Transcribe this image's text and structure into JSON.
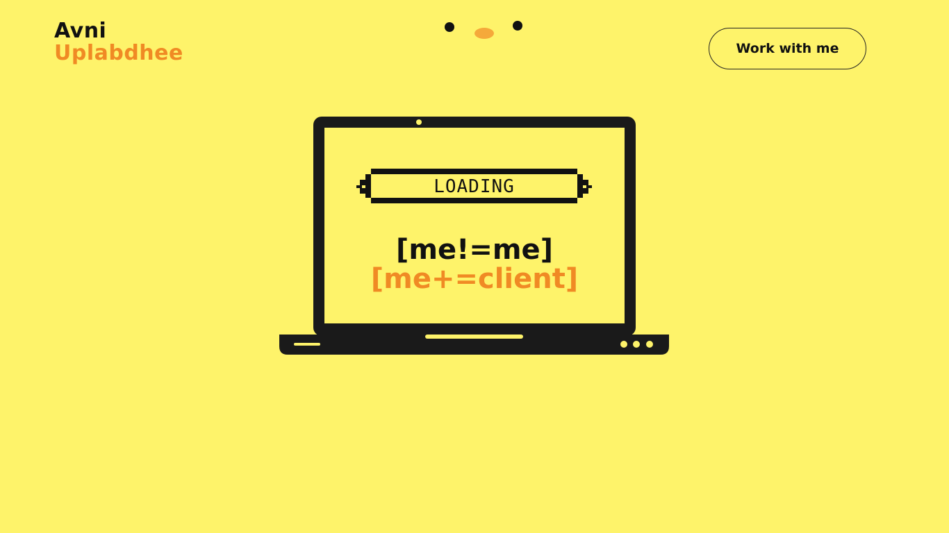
{
  "logo": {
    "first": "Avni",
    "last": "Uplabdhee"
  },
  "header": {
    "cta_label": "Work with me"
  },
  "hero": {
    "loading_label": "LOADING",
    "line1": "[me!=me]",
    "line2": "[me+=client]"
  },
  "colors": {
    "background": "#fef36a",
    "accent": "#f08a24",
    "ink": "#111111"
  },
  "icons": {
    "face": "face-decoration-icon",
    "laptop": "laptop-icon"
  }
}
